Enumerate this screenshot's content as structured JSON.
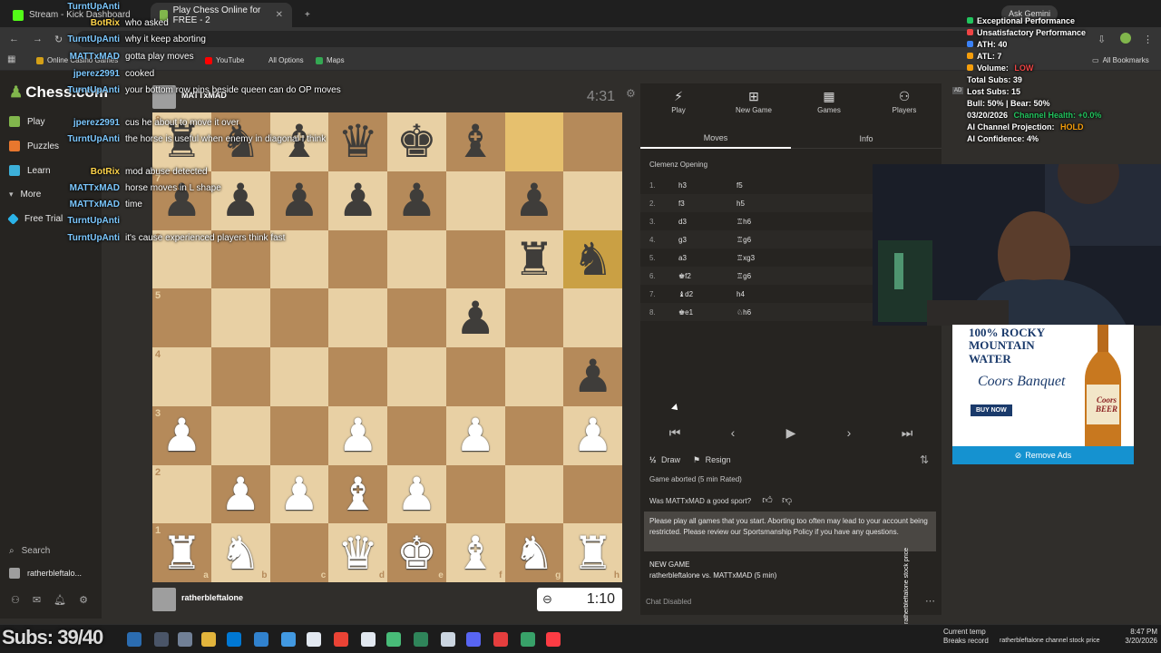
{
  "browser": {
    "tabs": [
      {
        "title": "Stream - Kick Dashboard",
        "favicon_color": "#53fc18"
      },
      {
        "title": "Play Chess Online for FREE - 2",
        "favicon_color": "#81b64c"
      }
    ],
    "bookmarks": [
      "Online Casino Games",
      "YouTube",
      "All Options",
      "Maps"
    ],
    "all_bookmarks": "All Bookmarks",
    "ask_gemini": "Ask Gemini"
  },
  "sidebar": {
    "logo": "Chess.com",
    "items": [
      {
        "label": "Play",
        "color": "#81b64c"
      },
      {
        "label": "Puzzles",
        "color": "#e8772e"
      },
      {
        "label": "Learn",
        "color": "#3db0d9"
      },
      {
        "label": "More",
        "color": "#9e9e9e"
      },
      {
        "label": "Free Trial",
        "color": "#2bb3e8"
      }
    ],
    "search": "Search",
    "user": "ratherbleftalo..."
  },
  "game": {
    "top_player": "MATTxMAD",
    "top_clock": "4:31",
    "bottom_player": "ratherbleftalone",
    "bottom_clock": "1:10",
    "board": [
      [
        "br",
        "bn",
        "bb",
        "bq",
        "bk",
        "bb",
        "",
        ""
      ],
      [
        "bp",
        "bp",
        "bp",
        "bp",
        "bp",
        "",
        "bp",
        ""
      ],
      [
        "",
        "",
        "",
        "",
        "",
        "",
        "br",
        "bn"
      ],
      [
        "",
        "",
        "",
        "",
        "",
        "bp",
        "",
        ""
      ],
      [
        "",
        "",
        "",
        "",
        "",
        "",
        "",
        "bp"
      ],
      [
        "wp",
        "",
        "",
        "wp",
        "",
        "wp",
        "",
        "wp"
      ],
      [
        "",
        "wp",
        "wp",
        "wb",
        "wp",
        "",
        "",
        ""
      ],
      [
        "wr",
        "wn",
        "",
        "wq",
        "wk",
        "wb",
        "wn",
        "wr"
      ]
    ],
    "highlights": [
      "g8",
      "h6"
    ],
    "ranks": [
      "8",
      "7",
      "6",
      "5",
      "4",
      "3",
      "2",
      "1"
    ],
    "files": [
      "a",
      "b",
      "c",
      "d",
      "e",
      "f",
      "g",
      "h"
    ]
  },
  "panel": {
    "tabs": [
      "Play",
      "New Game",
      "Games",
      "Players"
    ],
    "subtabs": [
      "Moves",
      "Info"
    ],
    "opening": "Clemenz Opening",
    "moves": [
      {
        "n": "1.",
        "w": "h3",
        "b": "f5"
      },
      {
        "n": "2.",
        "w": "f3",
        "b": "h5"
      },
      {
        "n": "3.",
        "w": "d3",
        "b": "♖h6"
      },
      {
        "n": "4.",
        "w": "g3",
        "b": "♖g6"
      },
      {
        "n": "5.",
        "w": "a3",
        "b": "♖xg3"
      },
      {
        "n": "6.",
        "w": "♚f2",
        "b": "♖g6"
      },
      {
        "n": "7.",
        "w": "♝d2",
        "b": "h4"
      },
      {
        "n": "8.",
        "w": "♚e1",
        "b": "♘h6"
      }
    ],
    "draw": "Draw",
    "draw_icon": "½",
    "resign": "Resign",
    "aborted": "Game aborted (5 min Rated)",
    "sport_question": "Was MATTxMAD a good sport?",
    "warning": "Please play all games that you start. Aborting too often may lead to your account being restricted. Please review our Sportsmanship Policy if you have any questions.",
    "new_game_title": "NEW GAME",
    "new_game_detail": "ratherbleftalone vs. MATTxMAD (5 min)",
    "chat_disabled": "Chat Disabled"
  },
  "chat": [
    {
      "user": "TurntUpAnti",
      "text": "",
      "color": "#7cc8ff"
    },
    {
      "user": "BotRix",
      "text": "who asked",
      "color": "#ffd44a"
    },
    {
      "user": "TurntUpAnti",
      "text": "why it keep aborting",
      "color": "#7cc8ff"
    },
    {
      "user": "MATTxMAD",
      "text": "gotta play moves",
      "color": "#7cc8ff"
    },
    {
      "user": "jperez2991",
      "text": "cooked",
      "color": "#7cc8ff"
    },
    {
      "user": "TurntUpAnti",
      "text": "your bottom row pins beside queen can do OP moves",
      "color": "#7cc8ff"
    },
    {
      "user": "jperez2991",
      "text": "cus he about to move it over",
      "color": "#7cc8ff"
    },
    {
      "user": "TurntUpAnti",
      "text": "the horse is useful when enemy in diagonal I think",
      "color": "#7cc8ff"
    },
    {
      "user": "BotRix",
      "text": "mod abuse detected",
      "color": "#ffd44a"
    },
    {
      "user": "MATTxMAD",
      "text": "horse moves in L shape",
      "color": "#7cc8ff"
    },
    {
      "user": "MATTxMAD",
      "text": "time",
      "color": "#7cc8ff"
    },
    {
      "user": "TurntUpAnti",
      "text": "",
      "color": "#7cc8ff"
    },
    {
      "user": "TurntUpAnti",
      "text": "it's cause experienced players think fast",
      "color": "#7cc8ff"
    }
  ],
  "stats": [
    {
      "text": "Exceptional Performance",
      "dot": "#22c55e"
    },
    {
      "text": "Unsatisfactory Performance",
      "dot": "#ef4444"
    },
    {
      "text": "ATH: 40",
      "dot": "#3b82f6"
    },
    {
      "text": "ATL: 7",
      "dot": "#f59e0b"
    },
    {
      "text": "Volume: ",
      "dot": "#f59e0b",
      "accent": "LOW"
    },
    {
      "text": "Total Subs: 39",
      "dot": ""
    },
    {
      "text": "Lost Subs: 15",
      "dot": ""
    },
    {
      "text": "Bull: 50% | Bear: 50%",
      "dot": ""
    },
    {
      "text": "03/20/2026 ",
      "dot": "",
      "accent": "Channel Health: +0.0%"
    },
    {
      "text": "AI Channel Projection: ",
      "dot": "",
      "accent": "HOLD"
    },
    {
      "text": "AI Confidence: 4%",
      "dot": ""
    }
  ],
  "ad": {
    "headline": "100% ROCKY MOUNTAIN WATER",
    "brand": "Coors Banquet",
    "cta": "BUY NOW",
    "bottle_text": "Coors BEER",
    "remove": "Remove Ads"
  },
  "overlay": {
    "subs_goal": "Subs: 39/40",
    "ticker": "ratherbleftalone stock price"
  },
  "taskbar": {
    "weather_title": "Current temp",
    "weather_sub": "Breaks record",
    "ticker": "ratherbleftalone channel stock price",
    "time": "8:47 PM",
    "date": "3/20/2026"
  }
}
